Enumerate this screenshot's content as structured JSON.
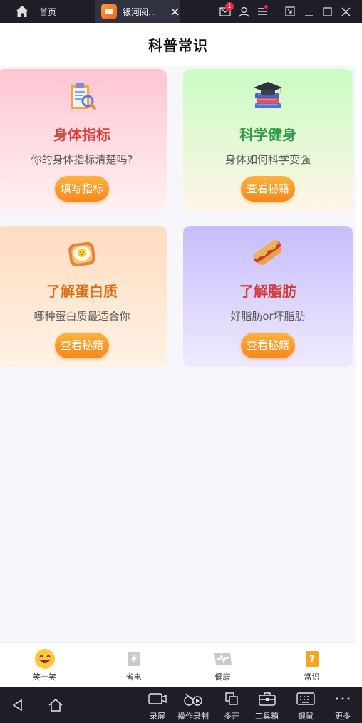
{
  "emulator_top": {
    "home_label": "首页",
    "tab_label": "银河阅...",
    "notification_count": "1"
  },
  "app": {
    "title": "科普常识",
    "cards": [
      {
        "title": "身体指标",
        "subtitle": "你的身体指标清楚吗?",
        "button": "填写指标",
        "title_color": "#d8423c",
        "icon": "clipboard-icon"
      },
      {
        "title": "科学健身",
        "subtitle": "身体如何科学变强",
        "button": "查看秘籍",
        "title_color": "#2f9d4b",
        "icon": "books-graduation-cap-icon"
      },
      {
        "title": "了解蛋白质",
        "subtitle": "哪种蛋白质最适合你",
        "button": "查看秘籍",
        "title_color": "#d9711a",
        "icon": "egg-toast-icon"
      },
      {
        "title": "了解脂肪",
        "subtitle": "好脂肪or坏脂肪",
        "button": "查看秘籍",
        "title_color": "#d23c3c",
        "icon": "hotdog-icon"
      }
    ],
    "bottom_nav": [
      {
        "label": "笑一笑",
        "icon": "smile-emoji-icon",
        "active": false
      },
      {
        "label": "省电",
        "icon": "battery-save-icon",
        "active": false
      },
      {
        "label": "健康",
        "icon": "heartbeat-icon",
        "active": false
      },
      {
        "label": "常识",
        "icon": "question-book-icon",
        "active": true
      }
    ]
  },
  "emulator_bottom": {
    "tools": [
      {
        "label": "录屏",
        "icon": "screen-record-icon"
      },
      {
        "label": "操作录制",
        "icon": "macro-record-icon"
      },
      {
        "label": "多开",
        "icon": "multi-instance-icon"
      },
      {
        "label": "工具箱",
        "icon": "toolbox-icon"
      },
      {
        "label": "键鼠",
        "icon": "keyboard-icon"
      },
      {
        "label": "更多",
        "icon": "more-icon"
      }
    ]
  },
  "colors": {
    "accent_orange": "#f7871d",
    "emulator_bar": "#1e1f26",
    "badge_red": "#e8274b"
  }
}
